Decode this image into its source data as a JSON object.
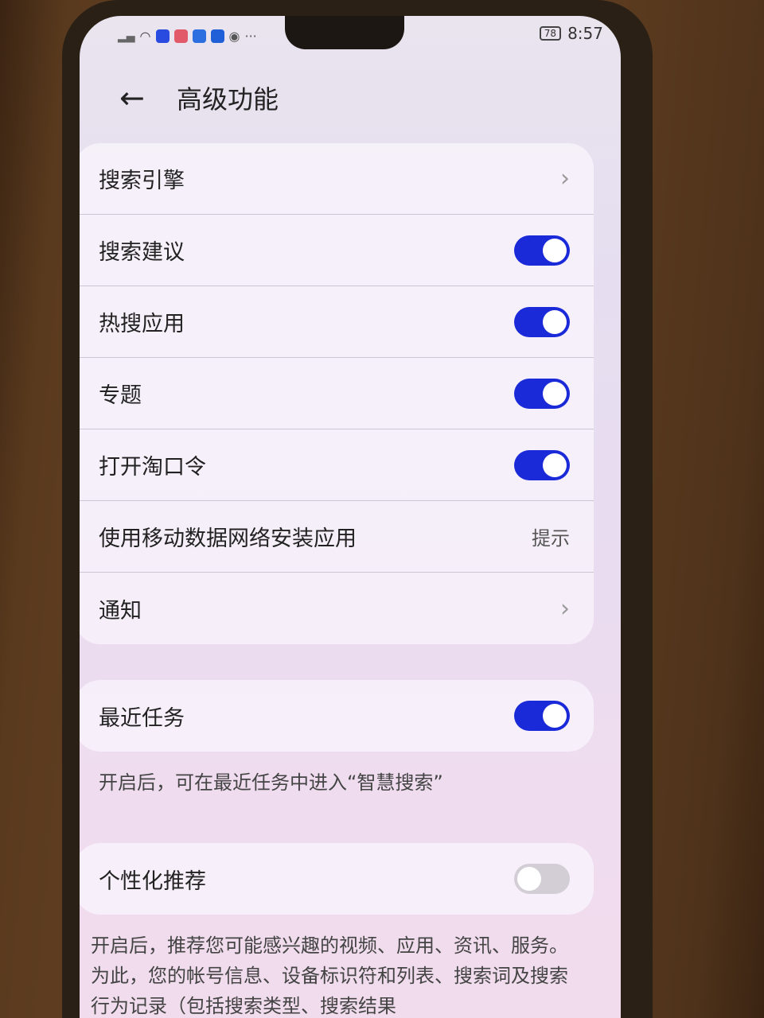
{
  "status": {
    "battery": "78",
    "time": "8:57",
    "dots": "···"
  },
  "header": {
    "title": "高级功能"
  },
  "main_card": {
    "search_engine": "搜索引擎",
    "search_suggest": "搜索建议",
    "hot_apps": "热搜应用",
    "topics": "专题",
    "taobao_code": "打开淘口令",
    "mobile_install": "使用移动数据网络安装应用",
    "mobile_install_value": "提示",
    "notify": "通知"
  },
  "recent": {
    "label": "最近任务",
    "desc": "开启后，可在最近任务中进入“智慧搜索”"
  },
  "personal": {
    "label": "个性化推荐",
    "desc": "开启后，推荐您可能感兴趣的视频、应用、资讯、服务。为此，您的帐号信息、设备标识符和列表、搜索词及搜索行为记录（包括搜索类型、搜索结果"
  },
  "toggles": {
    "search_suggest": "on",
    "hot_apps": "on",
    "topics": "on",
    "taobao_code": "on",
    "recent": "on",
    "personal": "off"
  },
  "colors": {
    "toggle_on": "#1b2ad8",
    "toggle_off": "#d3cdd6"
  }
}
